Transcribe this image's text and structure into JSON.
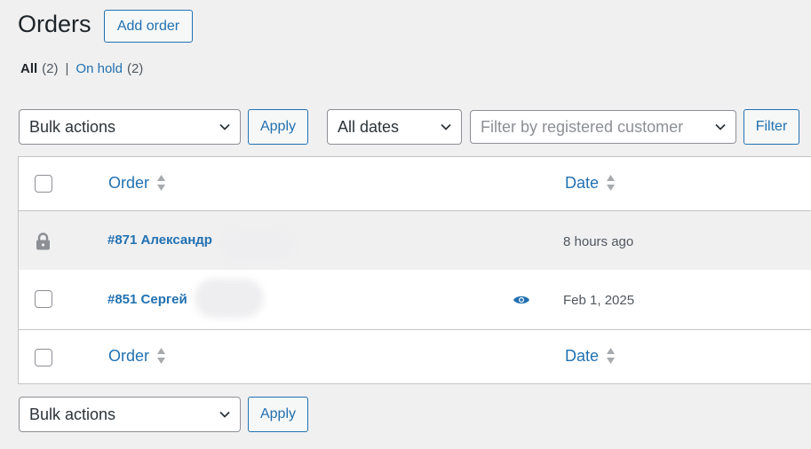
{
  "header": {
    "title": "Orders",
    "add_order_label": "Add order"
  },
  "views": {
    "all": {
      "label": "All",
      "count": "(2)"
    },
    "separator": "|",
    "on_hold": {
      "label": "On hold",
      "count": "(2)"
    }
  },
  "toolbar_top": {
    "bulk_actions": "Bulk actions",
    "apply": "Apply",
    "dates": "All dates",
    "customer_placeholder": "Filter by registered customer",
    "filter": "Filter"
  },
  "table": {
    "columns": {
      "order": "Order",
      "date": "Date"
    },
    "rows": [
      {
        "order": "#871 Александр",
        "date": "8 hours ago",
        "locked": true
      },
      {
        "order": "#851 Сергей",
        "date": "Feb 1, 2025",
        "locked": false
      }
    ]
  },
  "toolbar_bottom": {
    "bulk_actions": "Bulk actions",
    "apply": "Apply"
  },
  "colors": {
    "accent": "#2271b1",
    "background": "#f0f0f1",
    "border": "#c3c4c7"
  },
  "icons": [
    "chevron-down-icon",
    "sort-icon",
    "lock-icon",
    "eye-icon"
  ]
}
